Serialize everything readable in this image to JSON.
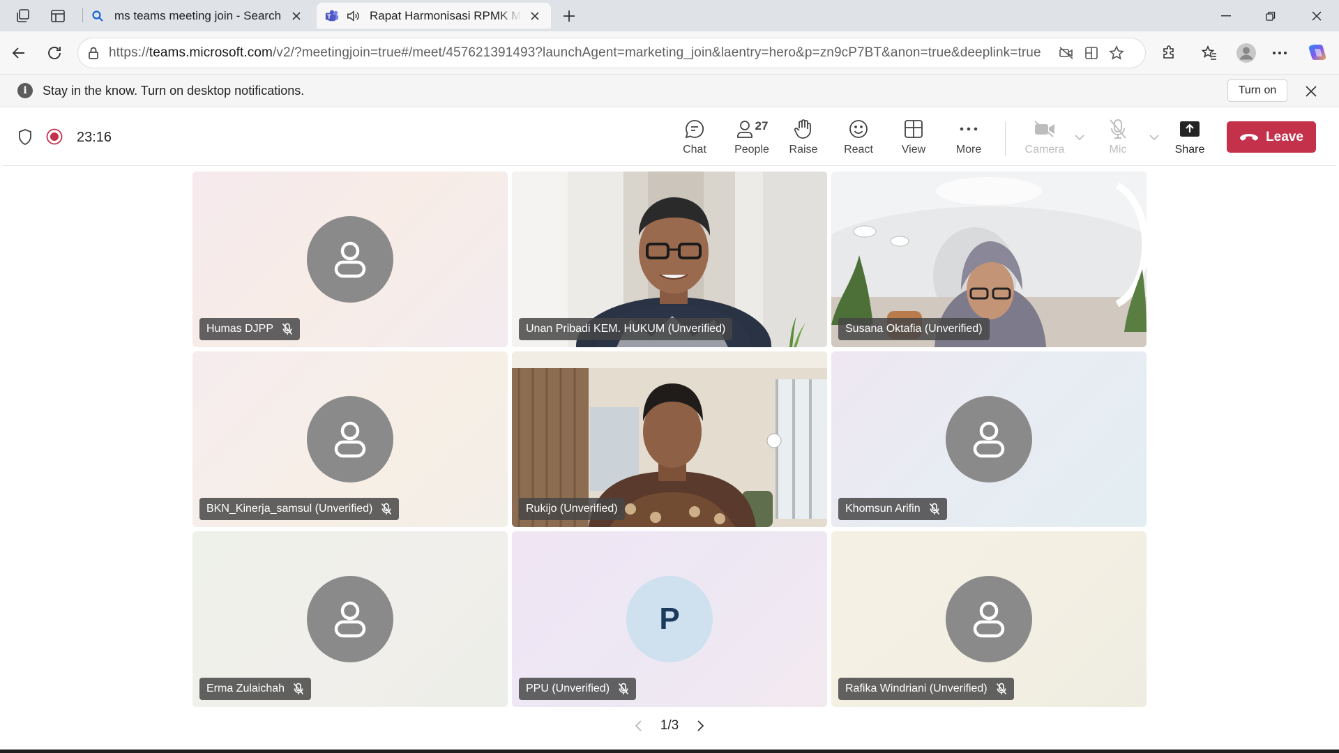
{
  "browser": {
    "tabs": [
      {
        "title": "ms teams meeting join - Search",
        "favicon": "search-icon"
      },
      {
        "title": "Rapat Harmonisasi RPMK Menteri",
        "favicon": "teams-icon",
        "audio": "speaker-icon"
      }
    ],
    "address": {
      "prefix": "https://",
      "domain": "teams.microsoft.com",
      "rest": "/v2/?meetingjoin=true#/meet/457621391493?launchAgent=marketing_join&laentry=hero&p=zn9cP7BT&anon=true&deeplink=true"
    }
  },
  "notification": {
    "text": "Stay in the know. Turn on desktop notifications.",
    "button_label": "Turn on"
  },
  "meeting": {
    "timer": "23:16",
    "controls": {
      "chat": "Chat",
      "people": "People",
      "people_count": "27",
      "raise": "Raise",
      "react": "React",
      "view": "View",
      "more": "More",
      "camera": "Camera",
      "mic": "Mic",
      "share": "Share",
      "leave": "Leave"
    },
    "accent": "#5b5fc7",
    "leave_color": "#c4314b"
  },
  "participants": [
    {
      "name": "Humas DJPP",
      "muted": true,
      "type": "avatar"
    },
    {
      "name": "Unan Pribadi KEM. HUKUM (Unverified)",
      "muted": false,
      "type": "video",
      "speaking": true
    },
    {
      "name": "Susana Oktafia (Unverified)",
      "muted": false,
      "type": "video"
    },
    {
      "name": "BKN_Kinerja_samsul (Unverified)",
      "muted": true,
      "type": "avatar"
    },
    {
      "name": "Rukijo (Unverified)",
      "muted": false,
      "type": "video"
    },
    {
      "name": "Khomsun Arifin",
      "muted": true,
      "type": "avatar"
    },
    {
      "name": "Erma Zulaichah",
      "muted": true,
      "type": "avatar"
    },
    {
      "name": "PPU (Unverified)",
      "muted": true,
      "type": "initial",
      "initial": "P"
    },
    {
      "name": "Rafika Windriani (Unverified)",
      "muted": true,
      "type": "avatar"
    }
  ],
  "pager": {
    "text": "1/3"
  }
}
